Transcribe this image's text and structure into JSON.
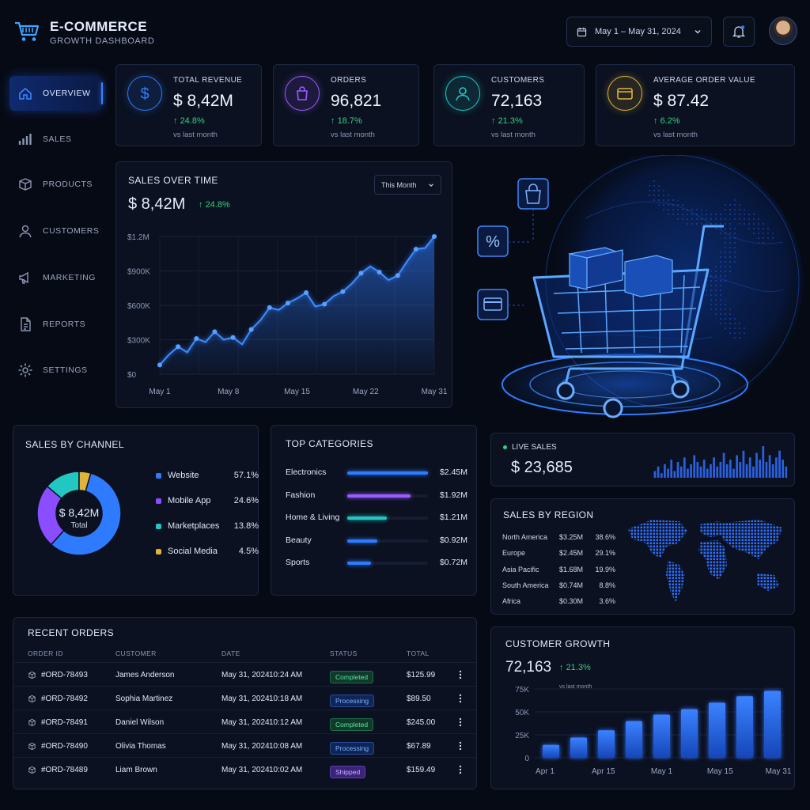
{
  "header": {
    "brand_title": "E-COMMERCE",
    "brand_subtitle": "GROWTH DASHBOARD",
    "date_range": "May 1 – May 31, 2024"
  },
  "sidebar": {
    "items": [
      {
        "label": "OVERVIEW",
        "icon": "home-icon"
      },
      {
        "label": "SALES",
        "icon": "bar-chart-icon"
      },
      {
        "label": "PRODUCTS",
        "icon": "box-icon"
      },
      {
        "label": "CUSTOMERS",
        "icon": "user-icon"
      },
      {
        "label": "MARKETING",
        "icon": "megaphone-icon"
      },
      {
        "label": "REPORTS",
        "icon": "document-icon"
      },
      {
        "label": "SETTINGS",
        "icon": "gear-icon"
      }
    ]
  },
  "kpis": [
    {
      "label": "TOTAL REVENUE",
      "value": "$ 8,42M",
      "change": "24.8%",
      "sub": "vs last month",
      "icon": "dollar-icon",
      "color": "#2f7bff"
    },
    {
      "label": "ORDERS",
      "value": "96,821",
      "change": "18.7%",
      "sub": "vs last month",
      "icon": "shopping-bag-icon",
      "color": "#9b5cff"
    },
    {
      "label": "CUSTOMERS",
      "value": "72,163",
      "change": "21.3%",
      "sub": "vs last month",
      "icon": "user-icon",
      "color": "#22c7c2"
    },
    {
      "label": "AVERAGE ORDER VALUE",
      "value": "$ 87.42",
      "change": "6.2%",
      "sub": "vs last month",
      "icon": "card-icon",
      "color": "#e0b43a"
    }
  ],
  "sales_over_time": {
    "title": "SALES OVER TIME",
    "value": "$ 8,42M",
    "change": "24.8%",
    "period": "This Month"
  },
  "sales_by_channel": {
    "title": "SALES BY CHANNEL",
    "center_value": "$ 8,42M",
    "center_label": "Total"
  },
  "top_categories": {
    "title": "TOP CATEGORIES",
    "items": [
      {
        "name": "Electronics",
        "value": "$2.45M",
        "amount": 2.45,
        "color": "#2f7bff"
      },
      {
        "name": "Fashion",
        "value": "$1.92M",
        "amount": 1.92,
        "color": "#9b5cff"
      },
      {
        "name": "Home & Living",
        "value": "$1.21M",
        "amount": 1.21,
        "color": "#22c7c2"
      },
      {
        "name": "Beauty",
        "value": "$0.92M",
        "amount": 0.92,
        "color": "#2f7bff"
      },
      {
        "name": "Sports",
        "value": "$0.72M",
        "amount": 0.72,
        "color": "#2f7bff"
      }
    ]
  },
  "live_sales": {
    "label": "LIVE SALES",
    "value": "$ 23,685"
  },
  "sales_by_region": {
    "title": "SALES BY REGION",
    "rows": [
      {
        "region": "North America",
        "value": "$3.25M",
        "pct": "38.6%"
      },
      {
        "region": "Europe",
        "value": "$2.45M",
        "pct": "29.1%"
      },
      {
        "region": "Asia Pacific",
        "value": "$1.68M",
        "pct": "19.9%"
      },
      {
        "region": "South America",
        "value": "$0.74M",
        "pct": "8.8%"
      },
      {
        "region": "Africa",
        "value": "$0.30M",
        "pct": "3.6%"
      }
    ]
  },
  "recent_orders": {
    "title": "RECENT ORDERS",
    "columns": [
      "ORDER ID",
      "CUSTOMER",
      "DATE",
      "STATUS",
      "TOTAL"
    ],
    "rows": [
      {
        "id": "#ORD-78493",
        "customer": "James Anderson",
        "date": "May 31, 2024",
        "time": "10:24 AM",
        "status": "Completed",
        "total": "$125.99"
      },
      {
        "id": "#ORD-78492",
        "customer": "Sophia Martinez",
        "date": "May 31, 2024",
        "time": "10:18 AM",
        "status": "Processing",
        "total": "$89.50"
      },
      {
        "id": "#ORD-78491",
        "customer": "Daniel Wilson",
        "date": "May 31, 2024",
        "time": "10:12 AM",
        "status": "Completed",
        "total": "$245.00"
      },
      {
        "id": "#ORD-78490",
        "customer": "Olivia Thomas",
        "date": "May 31, 2024",
        "time": "10:08 AM",
        "status": "Processing",
        "total": "$67.89"
      },
      {
        "id": "#ORD-78489",
        "customer": "Liam Brown",
        "date": "May 31, 2024",
        "time": "10:02 AM",
        "status": "Shipped",
        "total": "$159.49"
      }
    ]
  },
  "customer_growth": {
    "title": "CUSTOMER GROWTH",
    "value": "72,163",
    "change": "21.3%",
    "sub": "vs last month"
  },
  "chart_data": [
    {
      "type": "area",
      "title": "SALES OVER TIME",
      "x_ticks": [
        "May 1",
        "May 8",
        "May 15",
        "May 22",
        "May 31"
      ],
      "y_ticks": [
        "$0",
        "$300K",
        "$600K",
        "$900K",
        "$1.2M"
      ],
      "ylim": [
        0,
        1200000
      ],
      "x": [
        1,
        2,
        3,
        4,
        5,
        6,
        7,
        8,
        9,
        10,
        11,
        12,
        13,
        14,
        15,
        16,
        17,
        18,
        19,
        20,
        21,
        22,
        23,
        24,
        25,
        26,
        27,
        28,
        29,
        30,
        31
      ],
      "values": [
        80000,
        170000,
        240000,
        190000,
        310000,
        280000,
        370000,
        300000,
        320000,
        260000,
        390000,
        470000,
        580000,
        560000,
        620000,
        660000,
        710000,
        590000,
        610000,
        680000,
        720000,
        790000,
        880000,
        940000,
        890000,
        820000,
        860000,
        980000,
        1090000,
        1100000,
        1200000
      ],
      "grid": true
    },
    {
      "type": "pie",
      "title": "SALES BY CHANNEL",
      "labels": [
        "Website",
        "Mobile App",
        "Marketplaces",
        "Social Media"
      ],
      "values": [
        57.1,
        24.6,
        13.8,
        4.5
      ],
      "value_labels": [
        "57.1%",
        "24.6%",
        "13.8%",
        "4.5%"
      ],
      "colors": [
        "#2f7bff",
        "#8a4dff",
        "#22c7c2",
        "#e0b43a"
      ]
    },
    {
      "type": "bar",
      "title": "LIVE SALES",
      "values": [
        3,
        5,
        2,
        6,
        4,
        8,
        3,
        7,
        5,
        9,
        4,
        6,
        10,
        7,
        5,
        8,
        4,
        6,
        9,
        5,
        7,
        11,
        6,
        8,
        4,
        10,
        7,
        12,
        6,
        9,
        5,
        11,
        8,
        14,
        7,
        10,
        6,
        9,
        12,
        8,
        5
      ]
    },
    {
      "type": "bar",
      "title": "CUSTOMER GROWTH",
      "x_ticks": [
        "Apr 1",
        "Apr 15",
        "May 1",
        "May 15",
        "May 31"
      ],
      "y_ticks": [
        "0",
        "25K",
        "50K",
        "75K"
      ],
      "ylim": [
        0,
        75000
      ],
      "values": [
        14000,
        22000,
        30000,
        40000,
        47000,
        53000,
        60000,
        67000,
        73000
      ],
      "grid": true
    }
  ]
}
